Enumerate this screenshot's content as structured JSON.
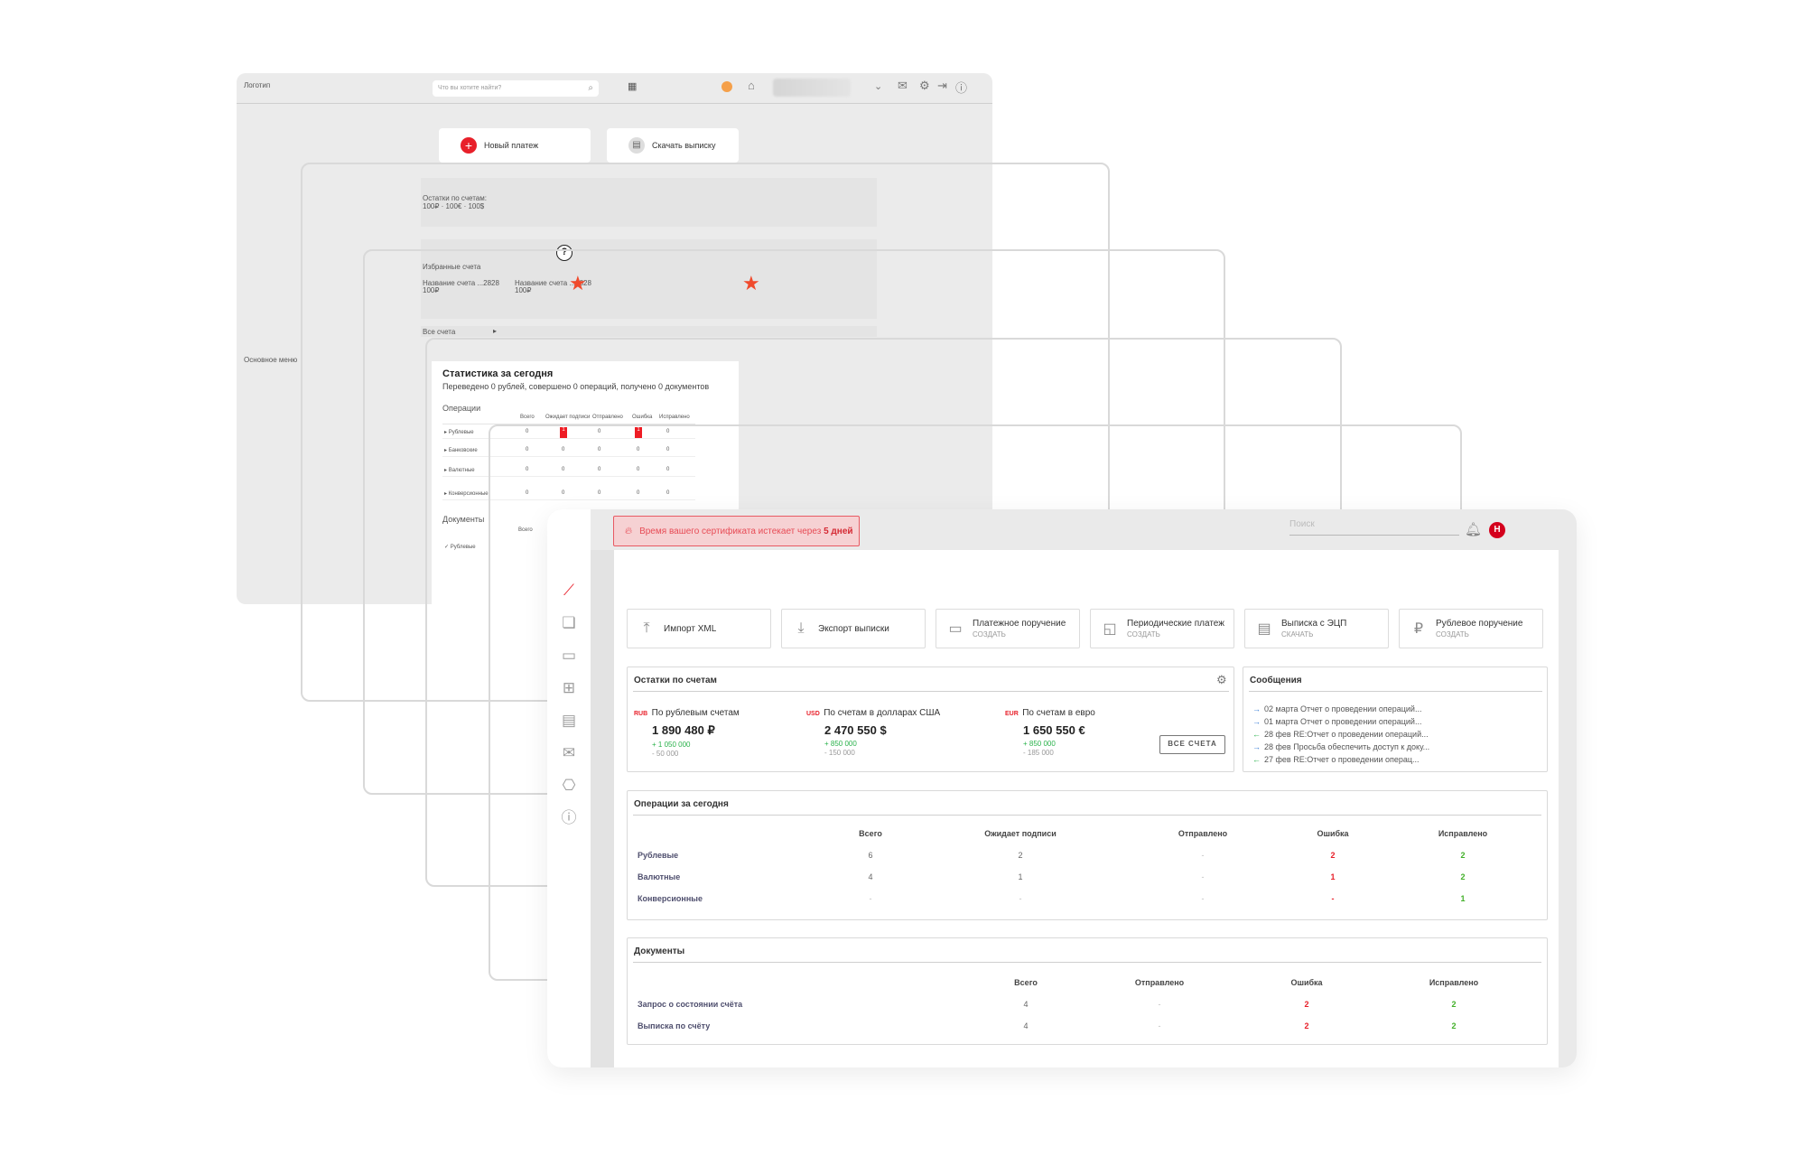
{
  "back": {
    "logo": "Логотип",
    "search_placeholder": "Что вы хотите найти?",
    "new_payment": "Новый платеж",
    "download_statement": "Скачать выписку",
    "balances_label": "Остатки по счетам:",
    "balances_values": "100₽ · 100€ · 100$",
    "favorites_label": "Избранные счета",
    "fav1_name": "Название счета ...2828",
    "fav1_amt": "100₽",
    "fav2_name": "Название счета ...2828",
    "fav2_amt": "100₽",
    "all_accounts": "Все счета",
    "main_menu": "Основное меню",
    "stats_title": "Статистика за сегодня",
    "stats_sub": "Переведено 0 рублей, совершено 0 операций, получено 0 документов",
    "ops_label": "Операции",
    "mini_headers": [
      "Всего",
      "Ожидает подписи",
      "Отправлено",
      "Ошибка",
      "Исправлено"
    ],
    "mini_rows": [
      {
        "label": "Рублевые",
        "values": [
          "0",
          "1",
          "0",
          "1",
          "0"
        ]
      },
      {
        "label": "Банковские",
        "values": [
          "0",
          "0",
          "0",
          "0",
          "0"
        ]
      },
      {
        "label": "Валютные",
        "values": [
          "0",
          "0",
          "0",
          "0",
          "0"
        ]
      },
      {
        "label": "Конверсионные",
        "values": [
          "0",
          "0",
          "0",
          "0",
          "0"
        ]
      }
    ],
    "docs_label": "Документы",
    "docs_total": "Всего",
    "docs_row": "Рублевые"
  },
  "alert": {
    "text": "Время вашего сертификата истекает через",
    "highlight": "5 дней"
  },
  "header": {
    "search_placeholder": "Поиск",
    "avatar_letter": "Н"
  },
  "quick_actions": [
    {
      "label": "Импорт XML",
      "sub": "",
      "icon": "upload-icon"
    },
    {
      "label": "Экспорт выписки",
      "sub": "",
      "icon": "download-icon"
    },
    {
      "label": "Платежное поручение",
      "sub": "СОЗДАТЬ",
      "icon": "card-icon"
    },
    {
      "label": "Периодические платеж",
      "sub": "СОЗДАТЬ",
      "icon": "document-icon"
    },
    {
      "label": "Выписка с ЭЦП",
      "sub": "СКАЧАТЬ",
      "icon": "list-icon"
    },
    {
      "label": "Рублевое поручение",
      "sub": "СОЗДАТЬ",
      "icon": "ruble-icon"
    }
  ],
  "balances": {
    "title": "Остатки по счетам",
    "items": [
      {
        "currency": "RUB",
        "label": "По рублевым счетам",
        "amount": "1 890 480 ₽",
        "income": "+ 1 050 000",
        "outcome": "- 50 000"
      },
      {
        "currency": "USD",
        "label": "По счетам в долларах США",
        "amount": "2 470 550 $",
        "income": "+ 850 000",
        "outcome": "- 150 000"
      },
      {
        "currency": "EUR",
        "label": "По счетам в евро",
        "amount": "1 650 550 €",
        "income": "+ 850 000",
        "outcome": "- 185 000"
      }
    ],
    "all_button": "ВСЕ СЧЕТА"
  },
  "messages": {
    "title": "Сообщения",
    "items": [
      {
        "text": "02 марта Отчет о проведении операций..."
      },
      {
        "text": "01 марта Отчет о проведении операций..."
      },
      {
        "text": "28 фев RE:Отчет о проведении операций..."
      },
      {
        "text": "28 фев Просьба обеспечить доступ к доку..."
      },
      {
        "text": "27 фев RE:Отчет о проведении операц..."
      }
    ]
  },
  "operations": {
    "title": "Операции за сегодня",
    "headers": [
      "Всего",
      "Ожидает подписи",
      "Отправлено",
      "Ошибка",
      "Исправлено"
    ],
    "rows": [
      {
        "label": "Рублевые",
        "values": [
          "6",
          "2",
          "-",
          "2",
          "2"
        ]
      },
      {
        "label": "Валютные",
        "values": [
          "4",
          "1",
          "-",
          "1",
          "2"
        ]
      },
      {
        "label": "Конверсионные",
        "values": [
          "-",
          "-",
          "-",
          "-",
          "1"
        ]
      }
    ]
  },
  "documents": {
    "title": "Документы",
    "headers": [
      "Всего",
      "Отправлено",
      "Ошибка",
      "Исправлено"
    ],
    "rows": [
      {
        "label": "Запрос о состоянии счёта",
        "values": [
          "4",
          "-",
          "2",
          "2"
        ]
      },
      {
        "label": "Выписка по счёту",
        "values": [
          "4",
          "-",
          "2",
          "2"
        ]
      }
    ]
  },
  "colors": {
    "accent": "#e8202a",
    "success": "#43b02a",
    "info": "#3b7fd6"
  }
}
